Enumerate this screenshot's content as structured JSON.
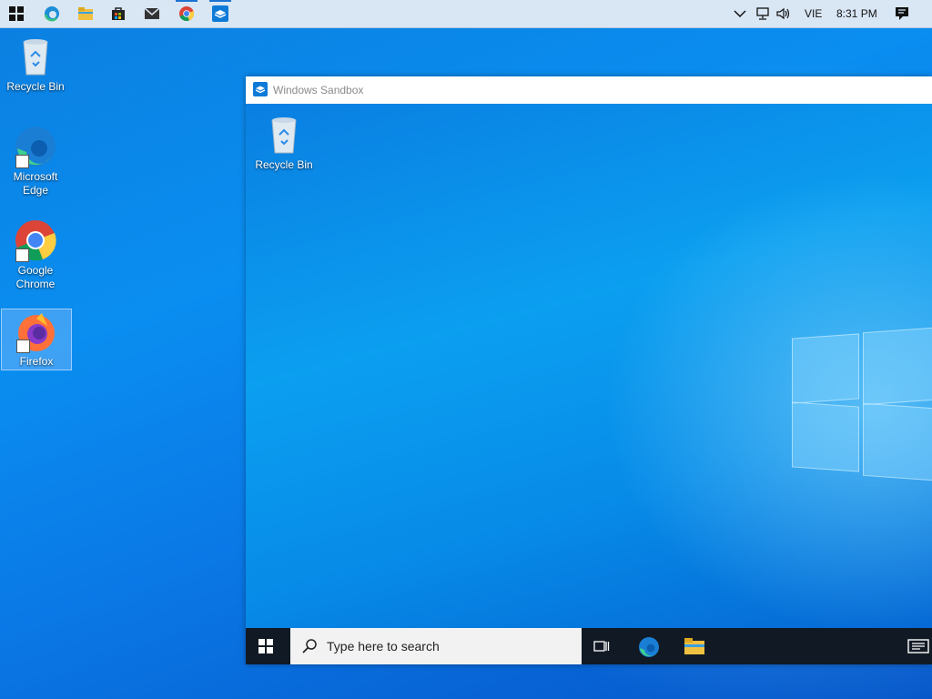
{
  "host": {
    "taskbar": {
      "pinned": [
        {
          "name": "start-button",
          "icon": "windows-logo-icon"
        },
        {
          "name": "edge",
          "icon": "edge-icon"
        },
        {
          "name": "file-explorer",
          "icon": "folder-icon"
        },
        {
          "name": "store",
          "icon": "store-bag-icon"
        },
        {
          "name": "mail",
          "icon": "mail-icon"
        },
        {
          "name": "chrome",
          "icon": "chrome-icon"
        },
        {
          "name": "sandbox",
          "icon": "sandbox-icon"
        }
      ],
      "tray": {
        "language": "VIE",
        "time": "8:31 PM"
      }
    },
    "desktop_icons": [
      {
        "label": "Recycle Bin"
      },
      {
        "label": "Microsoft Edge"
      },
      {
        "label": "Google Chrome"
      },
      {
        "label": "Firefox"
      }
    ]
  },
  "sandbox": {
    "title": "Windows Sandbox",
    "desktop_icons": [
      {
        "label": "Recycle Bin"
      }
    ],
    "taskbar": {
      "search_placeholder": "Type here to search"
    }
  },
  "colors": {
    "accent": "#1a73d1",
    "desktop_blue": "#0a8ef0",
    "taskbar_dark": "#111a24"
  }
}
